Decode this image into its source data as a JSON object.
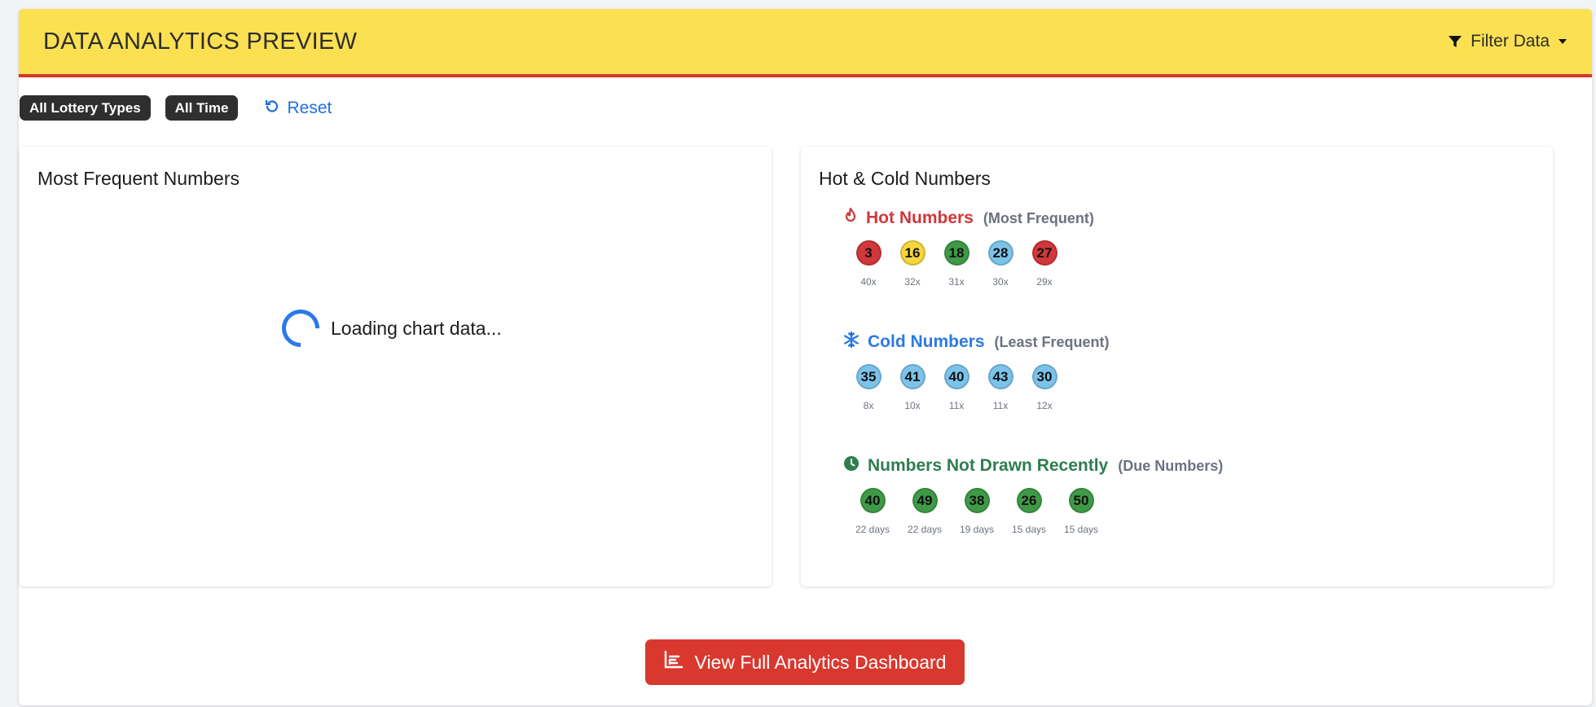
{
  "header": {
    "title": "DATA ANALYTICS PREVIEW",
    "filter_label": "Filter Data"
  },
  "filters": {
    "chips": [
      "All Lottery Types",
      "All Time"
    ],
    "reset_label": "Reset"
  },
  "left_panel": {
    "title": "Most Frequent Numbers",
    "loading_text": "Loading chart data..."
  },
  "right_panel": {
    "title": "Hot & Cold Numbers",
    "hot": {
      "title": "Hot Numbers",
      "subtitle": "(Most Frequent)",
      "items": [
        {
          "number": "3",
          "label": "40x",
          "color": "#d0383b"
        },
        {
          "number": "16",
          "label": "32x",
          "color": "#f5d63d"
        },
        {
          "number": "18",
          "label": "31x",
          "color": "#3f9a47"
        },
        {
          "number": "28",
          "label": "30x",
          "color": "#7cc3ea"
        },
        {
          "number": "27",
          "label": "29x",
          "color": "#d0383b"
        }
      ]
    },
    "cold": {
      "title": "Cold Numbers",
      "subtitle": "(Least Frequent)",
      "items": [
        {
          "number": "35",
          "label": "8x",
          "color": "#7cc3ea"
        },
        {
          "number": "41",
          "label": "10x",
          "color": "#7cc3ea"
        },
        {
          "number": "40",
          "label": "11x",
          "color": "#7cc3ea"
        },
        {
          "number": "43",
          "label": "11x",
          "color": "#7cc3ea"
        },
        {
          "number": "30",
          "label": "12x",
          "color": "#7cc3ea"
        }
      ]
    },
    "due": {
      "title": "Numbers Not Drawn Recently",
      "subtitle": "(Due Numbers)",
      "items": [
        {
          "number": "40",
          "label": "22 days",
          "color": "#3f9a47"
        },
        {
          "number": "49",
          "label": "22 days",
          "color": "#3f9a47"
        },
        {
          "number": "38",
          "label": "19 days",
          "color": "#3f9a47"
        },
        {
          "number": "26",
          "label": "15 days",
          "color": "#3f9a47"
        },
        {
          "number": "50",
          "label": "15 days",
          "color": "#3f9a47"
        }
      ]
    }
  },
  "cta": {
    "label": "View Full Analytics Dashboard"
  }
}
